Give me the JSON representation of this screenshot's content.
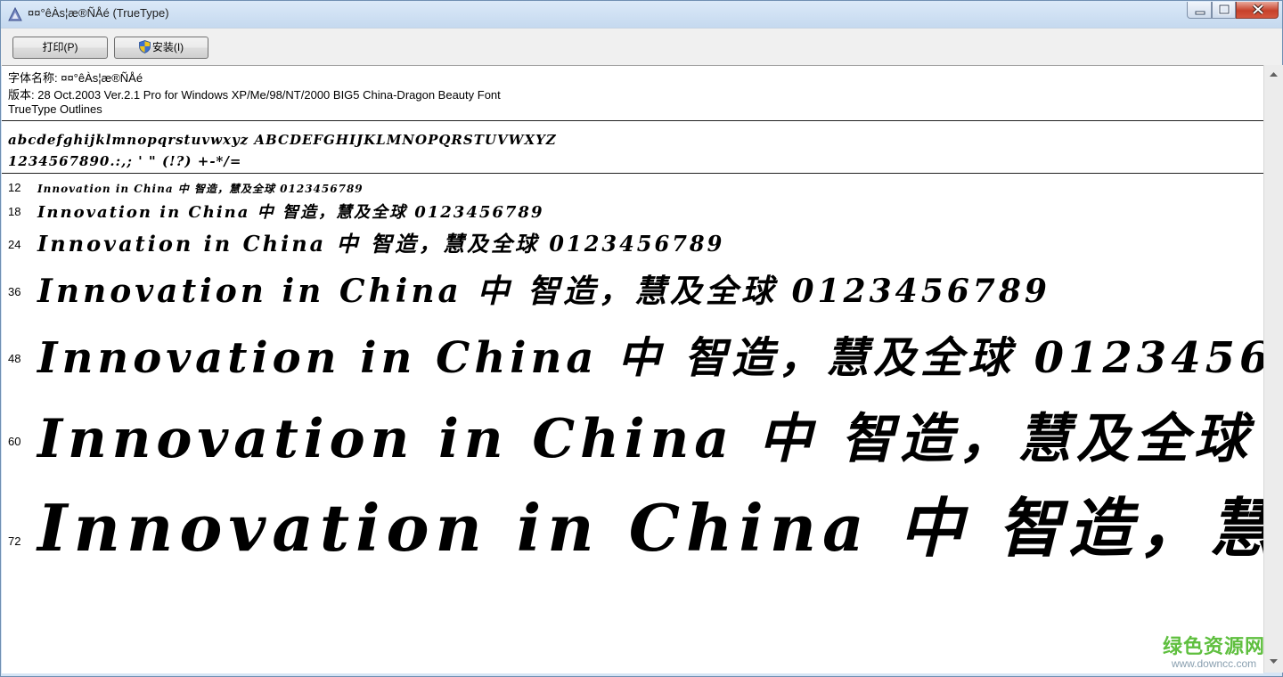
{
  "window": {
    "title": "¤¤°êÀs¦æ®ÑÅé (TrueType)"
  },
  "toolbar": {
    "print_label": "打印(P)",
    "install_label": "安装(I)"
  },
  "font_info": {
    "name_line": "字体名称: ¤¤°êÀs¦æ®ÑÅé",
    "version_line": "版本: 28 Oct.2003 Ver.2.1 Pro for Windows XP/Me/98/NT/2000 BIG5 China-Dragon Beauty Font",
    "type_line": "TrueType Outlines"
  },
  "charset": {
    "alphabet": "abcdefghijklmnopqrstuvwxyz ABCDEFGHIJKLMNOPQRSTUVWXYZ",
    "digits": "1234567890.:,; ' \" (!?) +-*/="
  },
  "samples": {
    "s12": {
      "size": "12",
      "text": "Innovation in China 中 智造，慧及全球 0123456789"
    },
    "s18": {
      "size": "18",
      "text": "Innovation in China 中 智造，慧及全球 0123456789"
    },
    "s24": {
      "size": "24",
      "text": "Innovation in China 中 智造，慧及全球 0123456789"
    },
    "s36": {
      "size": "36",
      "text": "Innovation in China 中 智造，慧及全球 0123456789"
    },
    "s48": {
      "size": "48",
      "text": "Innovation in China 中 智造，慧及全球 0123456"
    },
    "s60": {
      "size": "60",
      "text": "Innovation in China 中 智造，慧及全球"
    },
    "s72": {
      "size": "72",
      "text": "Innovation in China 中 智造，慧"
    }
  },
  "watermark": {
    "text_cn": "绿色资源网",
    "url": "www.downcc.com"
  },
  "colors": {
    "titlebar": "#c5d9ef",
    "close_button": "#c7412a",
    "watermark_green": "#5fbf3f"
  }
}
